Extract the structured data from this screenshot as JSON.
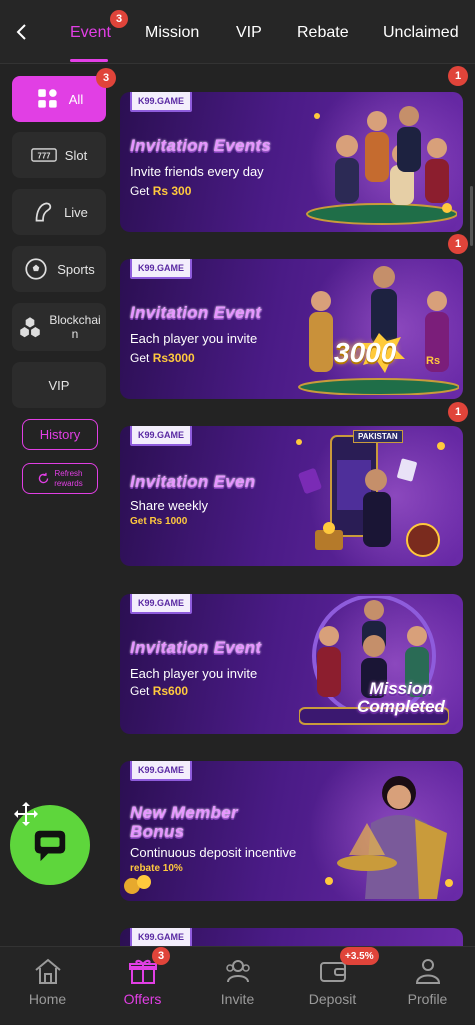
{
  "header": {
    "tabs": [
      {
        "label": "Event",
        "badge": "3"
      },
      {
        "label": "Mission"
      },
      {
        "label": "VIP"
      },
      {
        "label": "Rebate"
      },
      {
        "label": "Unclaimed"
      }
    ]
  },
  "sidebar": {
    "items": [
      {
        "label": "All",
        "badge": "3",
        "icon": "grid-icon"
      },
      {
        "label": "Slot",
        "icon": "slot-777-icon"
      },
      {
        "label": "Live",
        "icon": "live-dealer-icon"
      },
      {
        "label": "Sports",
        "icon": "soccer-ball-icon"
      },
      {
        "label": "Blockchai\nn",
        "icon": "blockchain-icon"
      },
      {
        "label": "VIP"
      }
    ],
    "history_label": "History",
    "refresh_label": "Refresh\nrewards"
  },
  "banners": [
    {
      "tag": "K99.GAME",
      "title": "Invitation Events",
      "desc": "Invite friends every day",
      "amount_prefix": "Get ",
      "amount": "Rs 300",
      "badge": "1"
    },
    {
      "tag": "K99.GAME",
      "title": "Invitation Event",
      "desc": "Each player you invite",
      "amount_prefix": "Get ",
      "amount": "Rs3000",
      "badge": "1",
      "art_text": "3000",
      "art_sub": "Rs"
    },
    {
      "tag": "K99.GAME",
      "title": "Invitation Even",
      "desc": "Share weekly",
      "amount_prefix": "Get Rs 1000",
      "amount": "",
      "badge": "1",
      "art_text": "PAKISTAN"
    },
    {
      "tag": "K99.GAME",
      "title": "Invitation Event",
      "desc": "Each player you invite",
      "amount_prefix": "Get ",
      "amount": "Rs600",
      "art_text": "Mission",
      "art_sub": "Completed"
    },
    {
      "tag": "K99.GAME",
      "title": "New Member\nBonus",
      "desc": "Continuous deposit incentive",
      "amount_prefix": "rebate 10%",
      "amount": ""
    },
    {
      "tag": "K99.GAME"
    }
  ],
  "bottom_nav": [
    {
      "label": "Home",
      "icon": "home-icon"
    },
    {
      "label": "Offers",
      "icon": "gift-icon",
      "badge": "3"
    },
    {
      "label": "Invite",
      "icon": "users-icon"
    },
    {
      "label": "Deposit",
      "icon": "wallet-icon",
      "badge": "+3.5%"
    },
    {
      "label": "Profile",
      "icon": "person-icon"
    }
  ],
  "colors": {
    "accent": "#e13fe4",
    "badge": "#e0443a",
    "fab": "#5ed63c",
    "gold": "#ffc93d"
  }
}
